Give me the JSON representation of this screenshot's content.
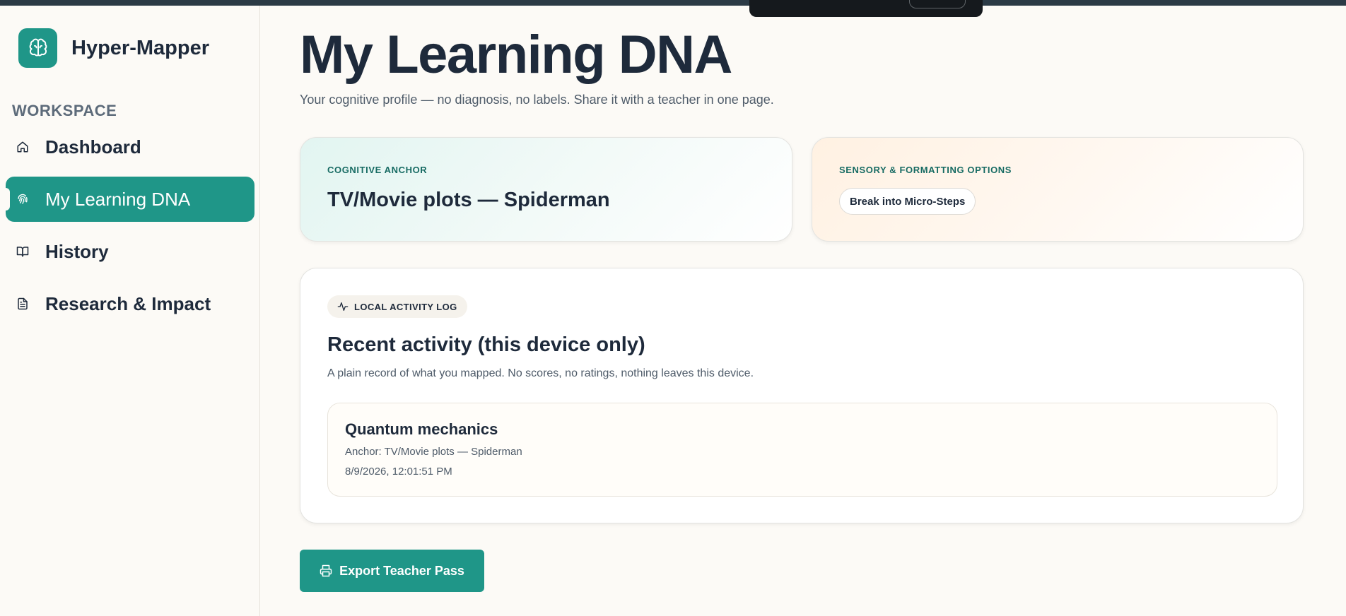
{
  "app": {
    "name": "Hyper-Mapper"
  },
  "sidebar": {
    "section_label": "WORKSPACE",
    "items": [
      {
        "label": "Dashboard",
        "icon": "home-icon"
      },
      {
        "label": "My Learning DNA",
        "icon": "fingerprint-icon",
        "active": true
      },
      {
        "label": "History",
        "icon": "book-open-icon"
      },
      {
        "label": "Research & Impact",
        "icon": "document-icon"
      }
    ]
  },
  "page": {
    "title": "My Learning DNA",
    "subtitle": "Your cognitive profile — no diagnosis, no labels. Share it with a teacher in one page."
  },
  "anchor_card": {
    "eyebrow": "COGNITIVE ANCHOR",
    "value": "TV/Movie plots — Spiderman"
  },
  "sensory_card": {
    "eyebrow": "SENSORY & FORMATTING OPTIONS",
    "chip_label": "Break into Micro-Steps"
  },
  "activity": {
    "pill_label": "LOCAL ACTIVITY LOG",
    "pill_icon": "activity-pulse-icon",
    "title": "Recent activity (this device only)",
    "description": "A plain record of what you mapped. No scores, no ratings, nothing leaves this device.",
    "entries": [
      {
        "topic": "Quantum mechanics",
        "anchor": "Anchor: TV/Movie plots — Spiderman",
        "timestamp": "8/9/2026, 12:01:51 PM"
      }
    ]
  },
  "export_button": {
    "label": "Export Teacher Pass",
    "icon": "printer-icon"
  },
  "colors": {
    "accent": "#1f9688",
    "text_primary": "#1e2a3b",
    "text_secondary": "#4e5b69",
    "background": "#fcfaf6"
  }
}
